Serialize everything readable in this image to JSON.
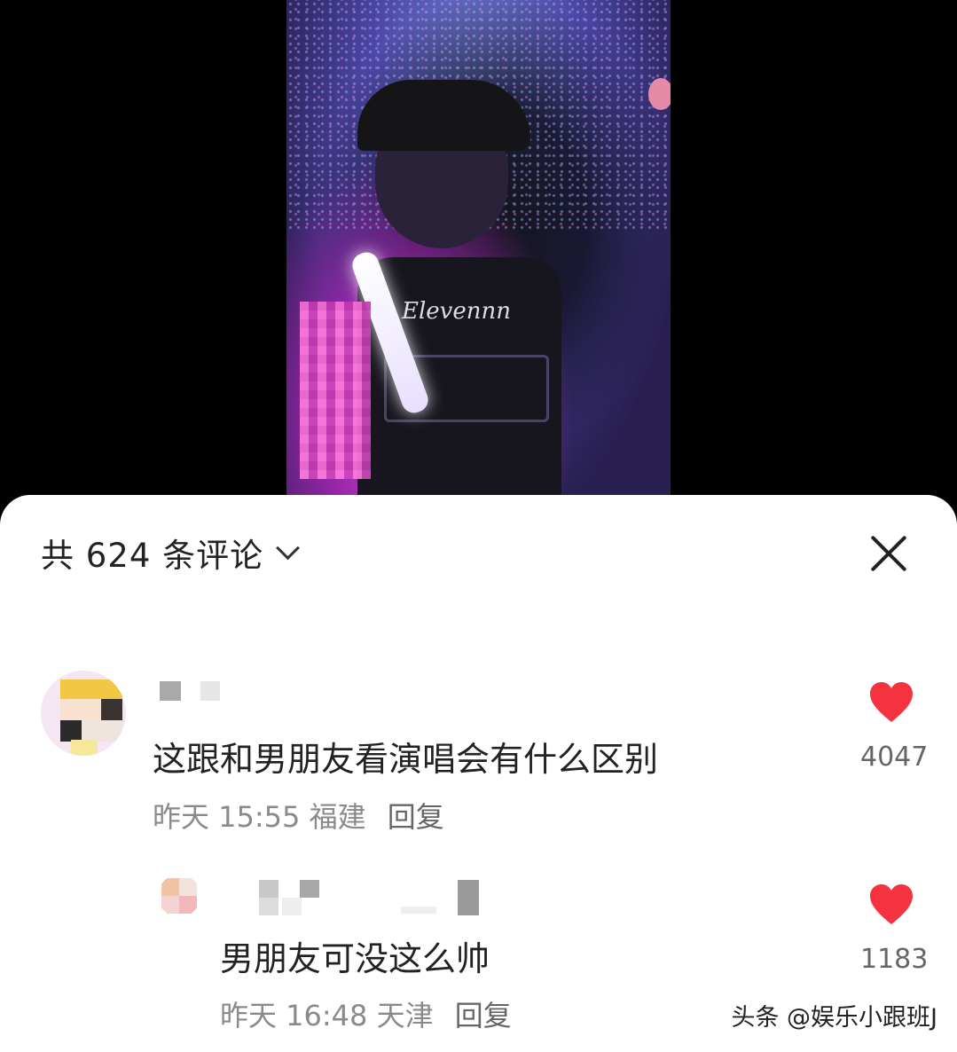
{
  "video": {
    "watermark": "Elevennn"
  },
  "comments_panel": {
    "title": "共 624 条评论",
    "comments": [
      {
        "text": "这跟和男朋友看演唱会有什么区别",
        "time": "昨天 15:55",
        "location": "福建",
        "reply_label": "回复",
        "likes": "4047"
      },
      {
        "text": "男朋友可没这么帅",
        "time": "昨天 16:48",
        "location": "天津",
        "reply_label": "回复",
        "likes": "1183"
      }
    ],
    "icons": {
      "close": "close-icon",
      "expand": "chevron-down-icon",
      "like": "heart-icon"
    },
    "colors": {
      "heart": "#f5323f",
      "text": "#222222",
      "meta": "#8a8a8a"
    }
  },
  "footer": {
    "source_mark": "头条 @娱乐小跟班J"
  }
}
